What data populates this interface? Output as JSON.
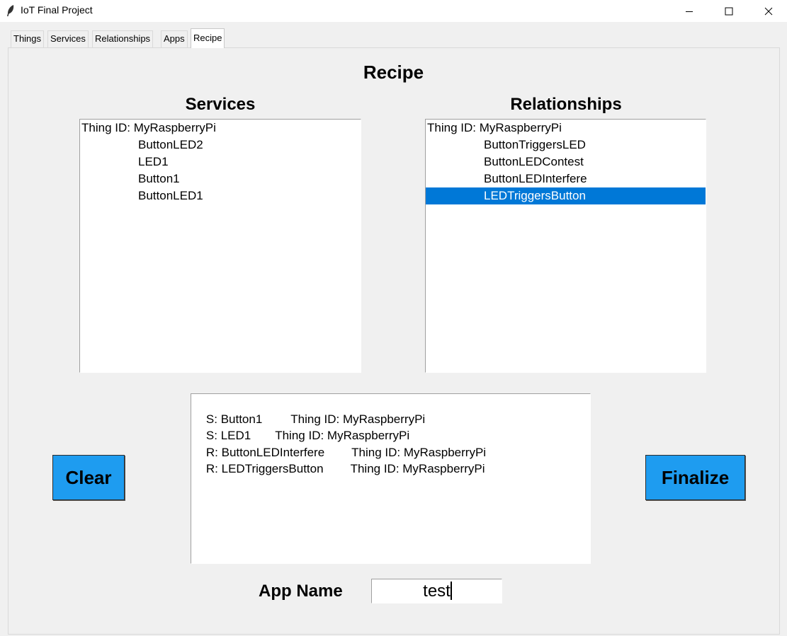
{
  "window": {
    "title": "IoT Final Project",
    "controls": {
      "minimize": "—",
      "maximize": "☐",
      "close": "✕"
    }
  },
  "tabs": [
    {
      "label": "Things"
    },
    {
      "label": "Services"
    },
    {
      "label": "Relationships"
    },
    {
      "label": "Apps"
    },
    {
      "label": "Recipe",
      "active": true
    }
  ],
  "recipe": {
    "title": "Recipe",
    "services": {
      "heading": "Services",
      "rows": [
        "Thing ID: MyRaspberryPi",
        "ButtonLED2",
        "LED1",
        "Button1",
        "ButtonLED1"
      ]
    },
    "relationships": {
      "heading": "Relationships",
      "rows": [
        "Thing ID: MyRaspberryPi",
        "ButtonTriggersLED",
        "ButtonLEDContest",
        "ButtonLEDInterfere",
        "LEDTriggersButton"
      ],
      "selected": "LEDTriggersButton"
    },
    "selected_items": [
      {
        "item": "S: Button1",
        "thing": "Thing ID: MyRaspberryPi"
      },
      {
        "item": "S: LED1",
        "thing": "Thing ID: MyRaspberryPi"
      },
      {
        "item": "R: ButtonLEDInterfere",
        "thing": "Thing ID: MyRaspberryPi"
      },
      {
        "item": "R: LEDTriggersButton",
        "thing": "Thing ID: MyRaspberryPi"
      }
    ],
    "clear_label": "Clear",
    "finalize_label": "Finalize",
    "app_name_label": "App Name",
    "app_name_value": "test"
  },
  "colors": {
    "button_bg": "#1e9cf0",
    "selection": "#0078d7"
  }
}
